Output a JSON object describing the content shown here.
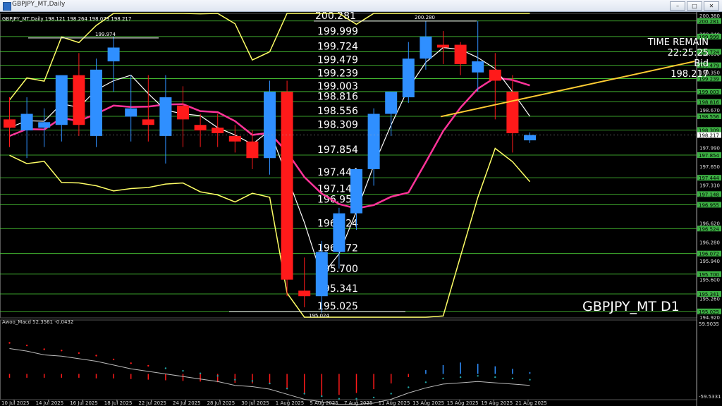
{
  "window": {
    "title": "GBPJPY_MT,Daily",
    "buttons": {
      "minimize": "–",
      "maximize": "□",
      "close": "✕"
    }
  },
  "symbol_line": {
    "symbol": "GBPJPY_MT,Daily",
    "ohlc": "198.121 198.264 198.073 198.217"
  },
  "overlay": {
    "symbol_timeframe": "GBPJPY_MT D1",
    "time_remain_label": "TIME REMAIN",
    "time_remain": "22:25:25",
    "bid_label": "Bid",
    "bid_value": "198.217"
  },
  "level_labels": [
    "200.281",
    "199.999",
    "199.724",
    "199.479",
    "199.239",
    "199.003",
    "198.816",
    "198.556",
    "198.309",
    "197.854",
    "197.444",
    "197.148",
    "196.955",
    "196.524",
    "196.072",
    "195.700",
    "195.341",
    "195.025"
  ],
  "high_low_markers": {
    "high_1": "199.974",
    "high_2": "200.280",
    "low": "195.024"
  },
  "price_axis": {
    "plain_ticks": [
      "200.380",
      "200.040",
      "199.690",
      "199.350",
      "199.010",
      "198.670",
      "198.330",
      "197.990",
      "197.650",
      "197.310",
      "196.960",
      "196.620",
      "196.280",
      "195.940",
      "195.600",
      "195.260",
      "194.920"
    ],
    "green_tags": [
      "200.281",
      "199.999",
      "199.724",
      "199.479",
      "199.239",
      "199.003",
      "198.816",
      "198.556",
      "198.309",
      "197.854",
      "197.444",
      "197.148",
      "196.955",
      "196.524",
      "196.072",
      "195.700",
      "195.341",
      "195.025"
    ],
    "current_tag": "198.217"
  },
  "indicator": {
    "label": "Awoo_Macd 52.3561 -0.0432",
    "axis_top": "59.9035",
    "axis_bottom": "-59.5331"
  },
  "date_axis": [
    "10 Jul 2025",
    "14 Jul 2025",
    "16 Jul 2025",
    "18 Jul 2025",
    "22 Jul 2025",
    "24 Jul 2025",
    "28 Jul 2025",
    "30 Jul 2025",
    "1 Aug 2025",
    "5 Aug 2025",
    "7 Aug 2025",
    "11 Aug 2025",
    "13 Aug 2025",
    "15 Aug 2025",
    "19 Aug 2025",
    "21 Aug 2025"
  ],
  "colors": {
    "bull": "#2f8fff",
    "bear": "#ff1a1a",
    "level_line": "#4cd137",
    "band": "#ffff66",
    "ma_pink": "#ff3399",
    "ma_white": "#ffffff",
    "trend": "#ffcc33"
  },
  "chart_data": {
    "type": "candlestick",
    "title": "GBPJPY_MT,Daily",
    "ylim": [
      194.92,
      200.38
    ],
    "candles": [
      {
        "o": 198.5,
        "h": 198.9,
        "l": 198.0,
        "c": 198.35
      },
      {
        "o": 198.3,
        "h": 198.9,
        "l": 197.8,
        "c": 198.6
      },
      {
        "o": 198.35,
        "h": 198.7,
        "l": 198.0,
        "c": 198.45
      },
      {
        "o": 198.4,
        "h": 199.2,
        "l": 198.1,
        "c": 199.3
      },
      {
        "o": 199.3,
        "h": 199.7,
        "l": 198.2,
        "c": 198.4
      },
      {
        "o": 198.2,
        "h": 199.6,
        "l": 198.0,
        "c": 199.4
      },
      {
        "o": 199.55,
        "h": 200.0,
        "l": 199.0,
        "c": 199.8
      },
      {
        "o": 198.55,
        "h": 199.3,
        "l": 198.1,
        "c": 198.7
      },
      {
        "o": 198.5,
        "h": 199.3,
        "l": 198.1,
        "c": 198.4
      },
      {
        "o": 198.2,
        "h": 199.3,
        "l": 197.7,
        "c": 198.9
      },
      {
        "o": 198.75,
        "h": 199.1,
        "l": 198.0,
        "c": 198.5
      },
      {
        "o": 198.4,
        "h": 198.6,
        "l": 198.0,
        "c": 198.3
      },
      {
        "o": 198.35,
        "h": 198.6,
        "l": 198.0,
        "c": 198.25
      },
      {
        "o": 198.2,
        "h": 198.4,
        "l": 197.9,
        "c": 198.1
      },
      {
        "o": 198.1,
        "h": 198.3,
        "l": 197.6,
        "c": 197.8
      },
      {
        "o": 197.8,
        "h": 199.2,
        "l": 197.5,
        "c": 199.0
      },
      {
        "o": 199.0,
        "h": 199.2,
        "l": 195.3,
        "c": 195.6
      },
      {
        "o": 195.4,
        "h": 196.0,
        "l": 195.1,
        "c": 195.3
      },
      {
        "o": 195.3,
        "h": 196.3,
        "l": 195.0,
        "c": 196.1
      },
      {
        "o": 196.1,
        "h": 196.9,
        "l": 195.8,
        "c": 196.8
      },
      {
        "o": 196.8,
        "h": 197.6,
        "l": 196.5,
        "c": 197.6
      },
      {
        "o": 197.6,
        "h": 198.7,
        "l": 197.3,
        "c": 198.6
      },
      {
        "o": 198.6,
        "h": 199.0,
        "l": 198.2,
        "c": 199.0
      },
      {
        "o": 198.9,
        "h": 199.9,
        "l": 198.8,
        "c": 199.6
      },
      {
        "o": 199.6,
        "h": 200.28,
        "l": 199.4,
        "c": 200.0
      },
      {
        "o": 199.85,
        "h": 200.1,
        "l": 199.5,
        "c": 199.8
      },
      {
        "o": 199.85,
        "h": 199.9,
        "l": 199.3,
        "c": 199.5
      },
      {
        "o": 199.35,
        "h": 200.28,
        "l": 199.0,
        "c": 199.55
      },
      {
        "o": 199.4,
        "h": 199.7,
        "l": 198.5,
        "c": 199.2
      },
      {
        "o": 199.0,
        "h": 199.3,
        "l": 197.9,
        "c": 198.25
      },
      {
        "o": 198.121,
        "h": 198.264,
        "l": 198.073,
        "c": 198.217
      }
    ],
    "macd_histogram": [
      -6,
      -6,
      -6,
      -6,
      -6,
      -7,
      -7,
      -8,
      -9,
      -10,
      -11,
      -12,
      -13,
      -14,
      -15,
      -16,
      -24,
      -30,
      -34,
      -33,
      -30,
      -24,
      -15,
      -5,
      6,
      14,
      18,
      16,
      12,
      8,
      3
    ],
    "macd_dots": [
      40,
      36,
      30,
      28,
      24,
      20,
      14,
      8,
      4,
      0,
      -4,
      -8,
      -12,
      -18,
      -20,
      -24,
      -32,
      -40,
      -44,
      -48,
      -48,
      -46,
      -40,
      -30,
      -22,
      -16,
      -14,
      -12,
      -14,
      -16,
      -18
    ]
  }
}
